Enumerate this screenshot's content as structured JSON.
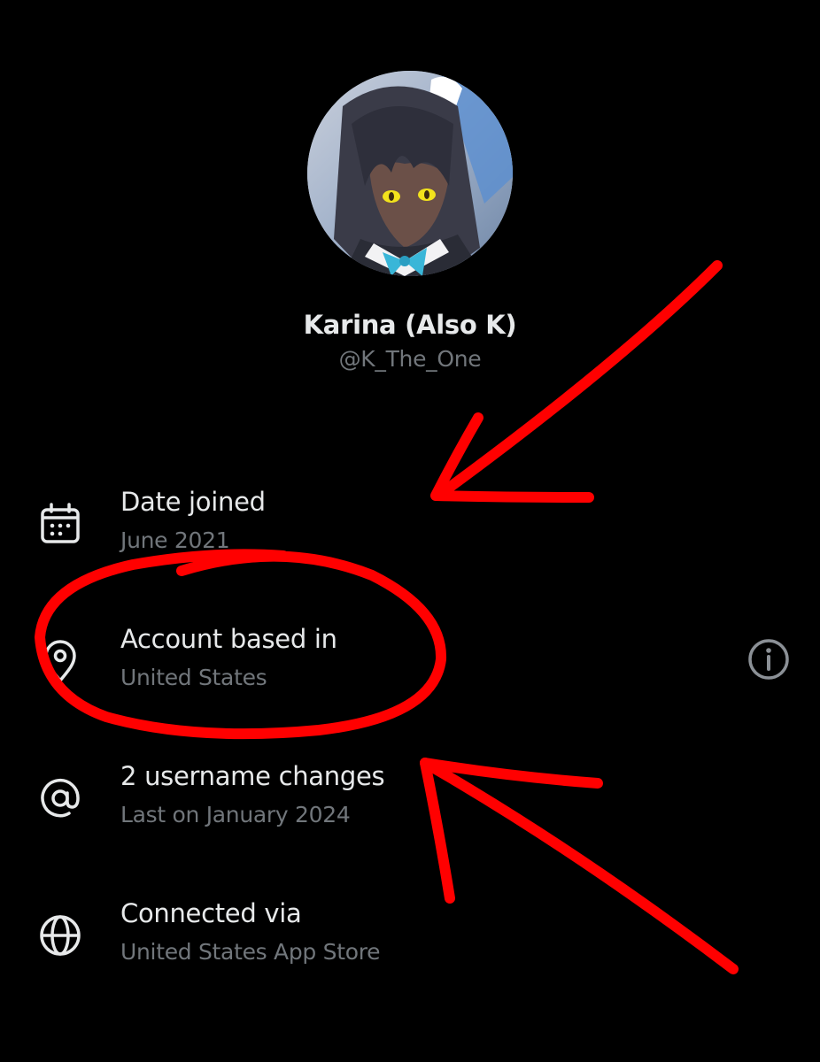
{
  "profile": {
    "display_name": "Karina (Also K)",
    "handle": "@K_The_One",
    "avatar_icon": "anime-character-avatar"
  },
  "info_rows": [
    {
      "icon": "calendar-icon",
      "title": "Date joined",
      "subtitle": "June 2021"
    },
    {
      "icon": "location-pin-icon",
      "title": "Account based in",
      "subtitle": "United States",
      "action_icon": "info-icon"
    },
    {
      "icon": "at-sign-icon",
      "title": "2 username changes",
      "subtitle": "Last on January 2024"
    },
    {
      "icon": "globe-icon",
      "title": "Connected via",
      "subtitle": "United States App Store"
    }
  ],
  "colors": {
    "background": "#000000",
    "primary_text": "#e7e9ea",
    "secondary_text": "#71767b",
    "annotation": "#ff0000"
  }
}
